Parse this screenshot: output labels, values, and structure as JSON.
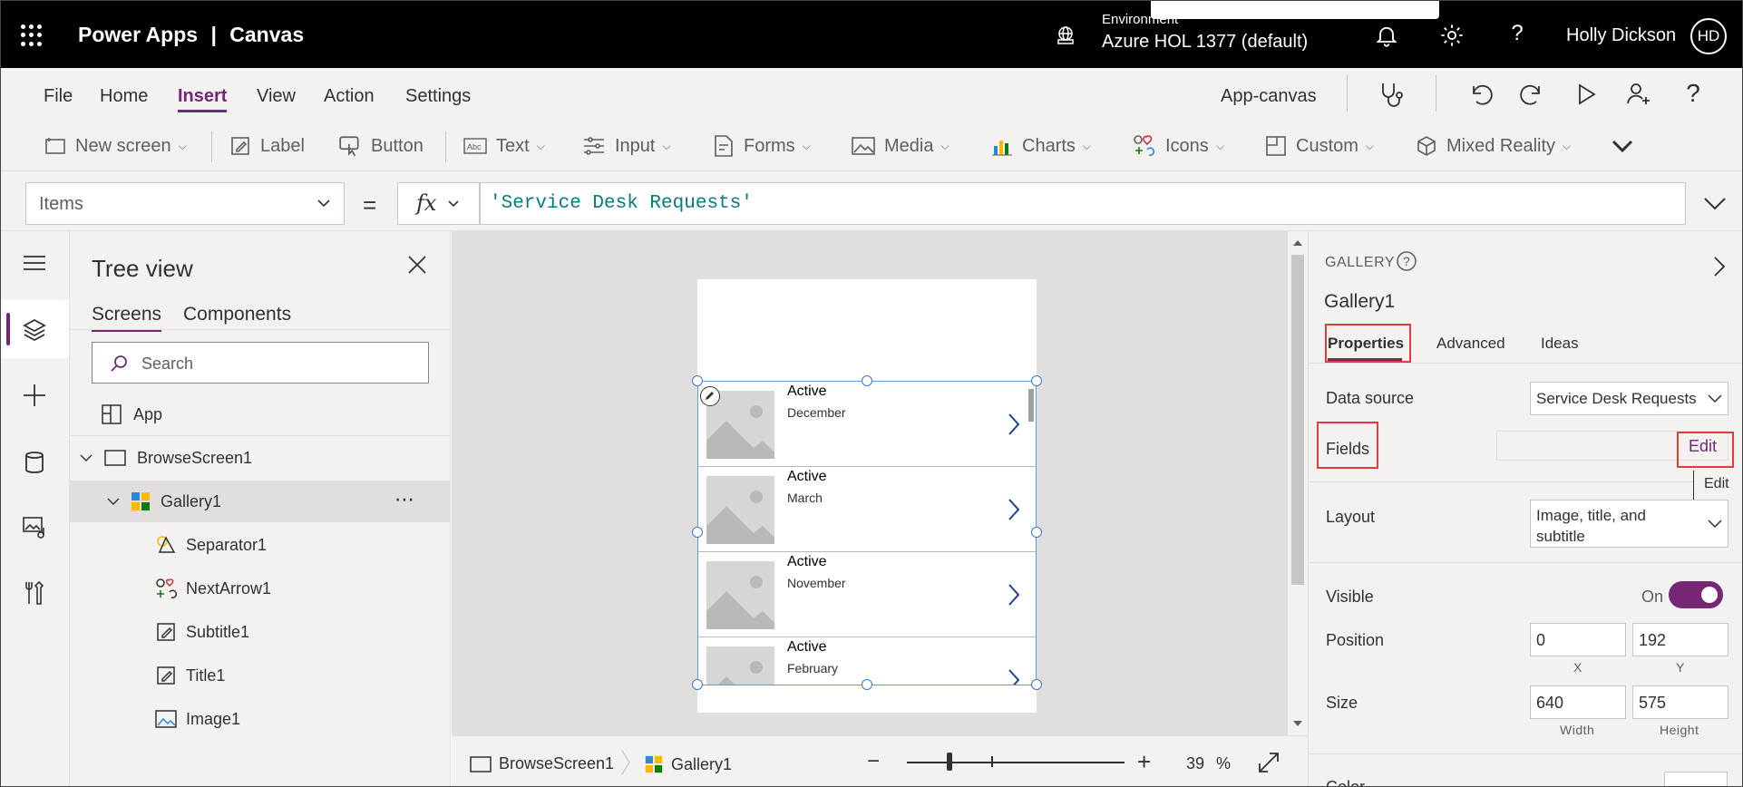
{
  "topbar": {
    "app_name": "Power Apps",
    "separator": "|",
    "app_type": "Canvas",
    "environment_label": "Environment",
    "environment_name": "Azure HOL 1377 (default)",
    "user_name": "Holly Dickson",
    "user_initials": "HD"
  },
  "menu": {
    "items": [
      "File",
      "Home",
      "Insert",
      "View",
      "Action",
      "Settings"
    ],
    "active": "Insert",
    "app_canvas_label": "App-canvas"
  },
  "toolbar": {
    "new_screen": "New screen",
    "label": "Label",
    "button": "Button",
    "text": "Text",
    "input": "Input",
    "forms": "Forms",
    "media": "Media",
    "charts": "Charts",
    "icons": "Icons",
    "custom": "Custom",
    "mixed_reality": "Mixed Reality"
  },
  "formula_bar": {
    "property": "Items",
    "equals": "=",
    "fx": "fx",
    "formula": "'Service Desk Requests'"
  },
  "tree_view": {
    "title": "Tree view",
    "tabs": [
      "Screens",
      "Components"
    ],
    "search_placeholder": "Search",
    "nodes": {
      "app": "App",
      "screen": "BrowseScreen1",
      "gallery": "Gallery1",
      "gallery_more": "⋯",
      "separator": "Separator1",
      "next_arrow": "NextArrow1",
      "subtitle": "Subtitle1",
      "title": "Title1",
      "image": "Image1"
    }
  },
  "gallery_items": [
    {
      "title": "Active",
      "subtitle": "December"
    },
    {
      "title": "Active",
      "subtitle": "March"
    },
    {
      "title": "Active",
      "subtitle": "November"
    },
    {
      "title": "Active",
      "subtitle": "February"
    }
  ],
  "statusbar": {
    "screen": "BrowseScreen1",
    "control": "Gallery1",
    "zoom_minus": "−",
    "zoom_plus": "+",
    "zoom_value": "39",
    "zoom_unit": "%"
  },
  "properties": {
    "type_label": "GALLERY",
    "control_name": "Gallery1",
    "tabs": [
      "Properties",
      "Advanced",
      "Ideas"
    ],
    "data_source_label": "Data source",
    "data_source_value": "Service Desk Requests",
    "fields_label": "Fields",
    "edit_link": "Edit",
    "edit_tooltip": "Edit",
    "layout_label": "Layout",
    "layout_value_line1": "Image, title, and",
    "layout_value_line2": "subtitle",
    "visible_label": "Visible",
    "visible_value": "On",
    "position_label": "Position",
    "position_x": "0",
    "position_y": "192",
    "x_label": "X",
    "y_label": "Y",
    "size_label": "Size",
    "size_width": "640",
    "size_height": "575",
    "width_label": "Width",
    "height_label": "Height",
    "color_label": "Color"
  },
  "colors": {
    "accent": "#742774",
    "highlight_box": "#e03c3c",
    "selection_handle": "#3b79c3"
  }
}
